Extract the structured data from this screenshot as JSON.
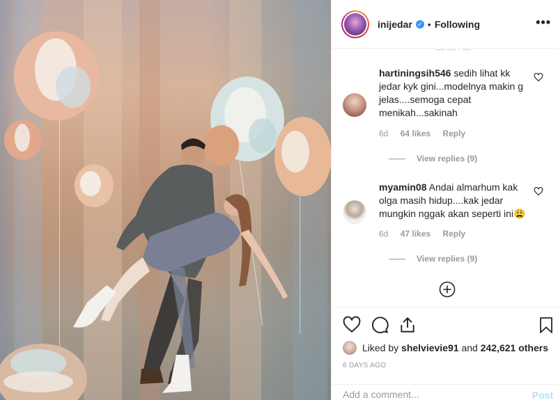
{
  "post": {
    "username": "inijedar",
    "verified_mark": "✓",
    "separator": "•",
    "follow_status": "Following",
    "more_glyph": "•••"
  },
  "comments": [
    {
      "username": "hartiningsih546",
      "text": "sedih lihat kk jedar kyk gini...modelnya makin g jelas....semoga cepat menikah...sakinah",
      "age": "6d",
      "likes": "64 likes",
      "reply_label": "Reply",
      "view_replies": "View replies (9)"
    },
    {
      "username": "myamin08",
      "text": "Andai almarhum kak olga masih hidup....kak jedar mungkin nggak akan seperti ini😩",
      "age": "6d",
      "likes": "47 likes",
      "reply_label": "Reply",
      "view_replies": "View replies (9)"
    }
  ],
  "likes": {
    "prefix": "Liked by",
    "user": "shelvievie91",
    "joiner": "and",
    "count": "242,621 others"
  },
  "timestamp": "6 DAYS AGO",
  "comment_box": {
    "placeholder": "Add a comment...",
    "post_label": "Post"
  },
  "icons": {
    "like": "heart-icon",
    "comment": "comment-icon",
    "share": "share-icon",
    "save": "bookmark-icon",
    "load_more": "plus-circle-icon"
  },
  "colors": {
    "accent_blue": "#3897f0",
    "post_disabled": "#b2dffc",
    "muted_text": "#999999"
  }
}
